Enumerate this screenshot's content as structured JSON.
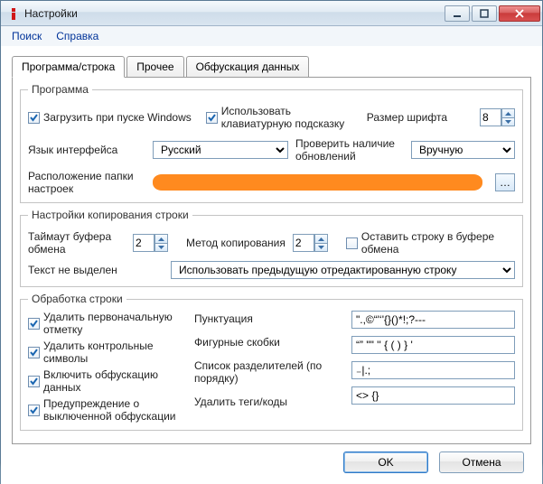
{
  "window": {
    "title": "Настройки"
  },
  "menu": {
    "search": "Поиск",
    "help": "Справка"
  },
  "tabs": {
    "t1": "Программа/строка",
    "t2": "Прочее",
    "t3": "Обфускация данных"
  },
  "prog": {
    "legend": "Программа",
    "loadOnStartup": "Загрузить при пуске Windows",
    "useKbTooltip": "Использовать клавиатурную подсказку",
    "fontSize": "Размер шрифта",
    "fontSizeVal": "8",
    "lang": "Язык интерфейса",
    "langVal": "Русский",
    "checkUpdates": "Проверить наличие обновлений",
    "checkUpdatesVal": "Вручную",
    "settingsFolder": "Расположение папки настроек"
  },
  "copy": {
    "legend": "Настройки копирования строки",
    "timeout": "Таймаут буфера обмена",
    "timeoutVal": "2",
    "method": "Метод копирования",
    "methodVal": "2",
    "leave": "Оставить строку в буфере обмена",
    "noSel": "Текст не выделен",
    "noSelVal": "Использовать предыдущую отредактированную строку"
  },
  "proc": {
    "legend": "Обработка строки",
    "removeInitMark": "Удалить первоначальную отметку",
    "removeCtrl": "Удалить контрольные символы",
    "enableObf": "Включить обфускацию данных",
    "warnObf": "Предупреждение о выключенной обфускации",
    "punct": "Пунктуация",
    "punctVal": "\".,©“'‘'{}()*!;?---",
    "braces": "Фигурные скобки",
    "bracesVal": "“” \"\" '' { ( ) } '",
    "sepList": "Список разделителей (по порядку)",
    "sepVal": "₋|.;",
    "removeTags": "Удалить теги/коды",
    "removeTagsVal": "<> {}"
  },
  "buttons": {
    "ok": "OK",
    "cancel": "Отмена"
  }
}
